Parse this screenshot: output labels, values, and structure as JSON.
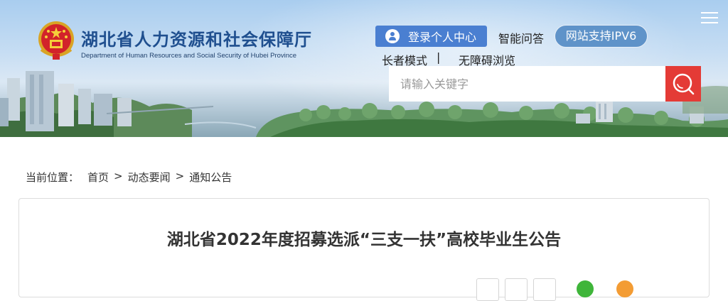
{
  "site": {
    "title_cn": "湖北省人力资源和社会保障厅",
    "title_en": "Department of Human Resources and Social Security of Hubei Province"
  },
  "topbar": {
    "login_label": "登录个人中心",
    "qa_label": "智能问答",
    "ipv6_label": "网站支持IPV6",
    "elder_label": "长者模式",
    "separator": "|",
    "barrier_free_label": "无障碍浏览"
  },
  "search": {
    "placeholder": "请输入关键字",
    "value": ""
  },
  "breadcrumb": {
    "label": "当前位置：",
    "items": [
      "首页",
      "动态要闻",
      "通知公告"
    ],
    "arrow": ">"
  },
  "article": {
    "title": "湖北省2022年度招募选派“三支一扶”高校毕业生公告"
  },
  "icons": {
    "logo": "national-emblem-icon",
    "login": "user-icon",
    "search": "search-icon",
    "menu": "menu-icon",
    "wechat": "wechat-icon",
    "weibo": "weibo-icon"
  },
  "colors": {
    "brand_blue": "#1f4f8f",
    "login_blue": "#4a7fd1",
    "ipv6_blue": "#5f93c9",
    "search_red": "#e43b36",
    "wechat_green": "#3fb53a",
    "weibo_orange": "#f39c34"
  }
}
